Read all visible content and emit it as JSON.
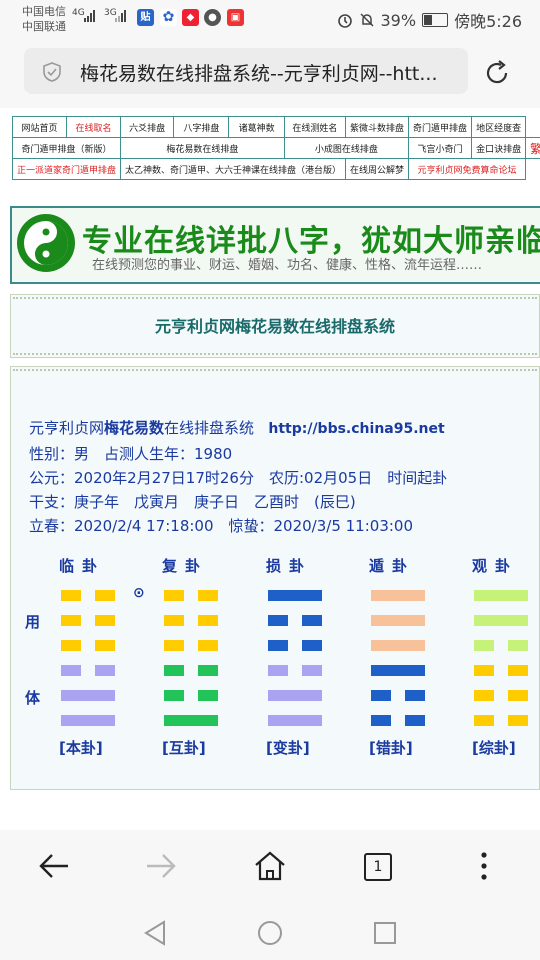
{
  "status_bar": {
    "carrier1": "中国电信",
    "carrier2": "中国联通",
    "sig1": "4G",
    "sig2": "3G",
    "battery": "39%",
    "time": "傍晚5:26"
  },
  "browser": {
    "url_text": "梅花易数在线排盘系统--元亨利贞网--htt...",
    "tab_count": "1"
  },
  "nav": {
    "row1": [
      "网站首页",
      "在线取名",
      "六爻排盘",
      "八字排盘",
      "诸葛神数",
      "在线测姓名",
      "紫微斗数排盘",
      "奇门遁甲排盘",
      "地区经度查"
    ],
    "row2": [
      "奇门遁甲排盘（新版）",
      "梅花易数在线排盘",
      "小成图在线排盘",
      "飞宫小奇门",
      "金口诀排盘",
      "繁體中文"
    ],
    "row3": [
      "正一派道家奇门遁甲排盘",
      "太乙神数、奇门遁甲、大六壬神课在线排盘（港台版）",
      "在线周公解梦",
      "元亨利贞网免费算命论坛"
    ]
  },
  "banner": {
    "headline": "专业在线详批八字，犹如大师亲临！",
    "sub": "在线预测您的事业、财运、婚姻、功名、健康、性格、流年运程……"
  },
  "page_title": "元亨利贞网梅花易数在线排盘系统",
  "info": {
    "line1_a": "元亨利贞网",
    "line1_b": "梅花易数",
    "line1_c": "在线排盘系统",
    "line1_d": "http://bbs.china95.net",
    "line2": "性别：男　占测人生年：1980",
    "line3": "公元：2020年2月27日17时26分　农历:02月05日　时间起卦",
    "line4": "干支：庚子年　戊寅月　庚子日　乙酉时　(辰巳)",
    "line5": "立春：2020/2/4 17:18:00　惊蛰：2020/3/5 11:03:00"
  },
  "side_labels": {
    "yong": "用",
    "ti": "体"
  },
  "moving_mark": "⊙",
  "hexagrams": [
    {
      "name": "临卦",
      "label": "[本卦]",
      "lines": [
        0,
        0,
        0,
        0,
        1,
        1
      ],
      "colors": [
        "#ffcc00",
        "#ffcc00",
        "#ffcc00",
        "#a9a3f2",
        "#a9a3f2",
        "#a9a3f2"
      ]
    },
    {
      "name": "复卦",
      "label": "[互卦]",
      "lines": [
        0,
        0,
        0,
        0,
        0,
        1
      ],
      "colors": [
        "#ffcc00",
        "#ffcc00",
        "#ffcc00",
        "#22c45a",
        "#22c45a",
        "#22c45a"
      ]
    },
    {
      "name": "损卦",
      "label": "[变卦]",
      "lines": [
        1,
        0,
        0,
        0,
        1,
        1
      ],
      "colors": [
        "#1e5fc8",
        "#1e5fc8",
        "#1e5fc8",
        "#a9a3f2",
        "#a9a3f2",
        "#a9a3f2"
      ]
    },
    {
      "name": "遁卦",
      "label": "[错卦]",
      "lines": [
        1,
        1,
        1,
        1,
        0,
        0
      ],
      "colors": [
        "#f7c29a",
        "#f7c29a",
        "#f7c29a",
        "#1e5fc8",
        "#1e5fc8",
        "#1e5fc8"
      ]
    },
    {
      "name": "观卦",
      "label": "[综卦]",
      "lines": [
        1,
        1,
        0,
        0,
        0,
        0
      ],
      "colors": [
        "#c6f27a",
        "#c6f27a",
        "#c6f27a",
        "#ffcc00",
        "#ffcc00",
        "#ffcc00"
      ]
    }
  ]
}
